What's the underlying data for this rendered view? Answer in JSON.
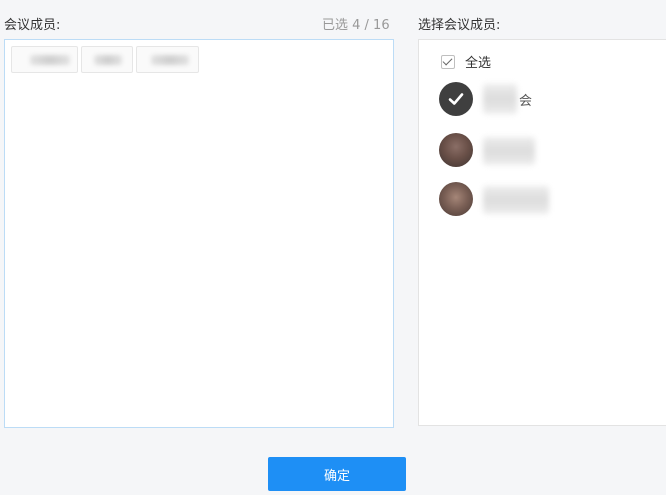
{
  "left": {
    "label": "会议成员:",
    "count": "已选 4 / 16",
    "chips": [
      "",
      "",
      ""
    ]
  },
  "right": {
    "label": "选择会议成员:",
    "select_all": "全选",
    "members": [
      {
        "avatar": "check-icon",
        "selected": true,
        "visible_char": "会"
      },
      {
        "avatar": "photo",
        "selected": false,
        "visible_char": ""
      },
      {
        "avatar": "photo",
        "selected": false,
        "visible_char": ""
      }
    ]
  },
  "footer": {
    "confirm_label": "确定"
  },
  "colors": {
    "accent": "#1e8ff5",
    "left_border": "#bcdcf6",
    "right_border": "#e3e3e3",
    "background": "#f5f6f8"
  }
}
